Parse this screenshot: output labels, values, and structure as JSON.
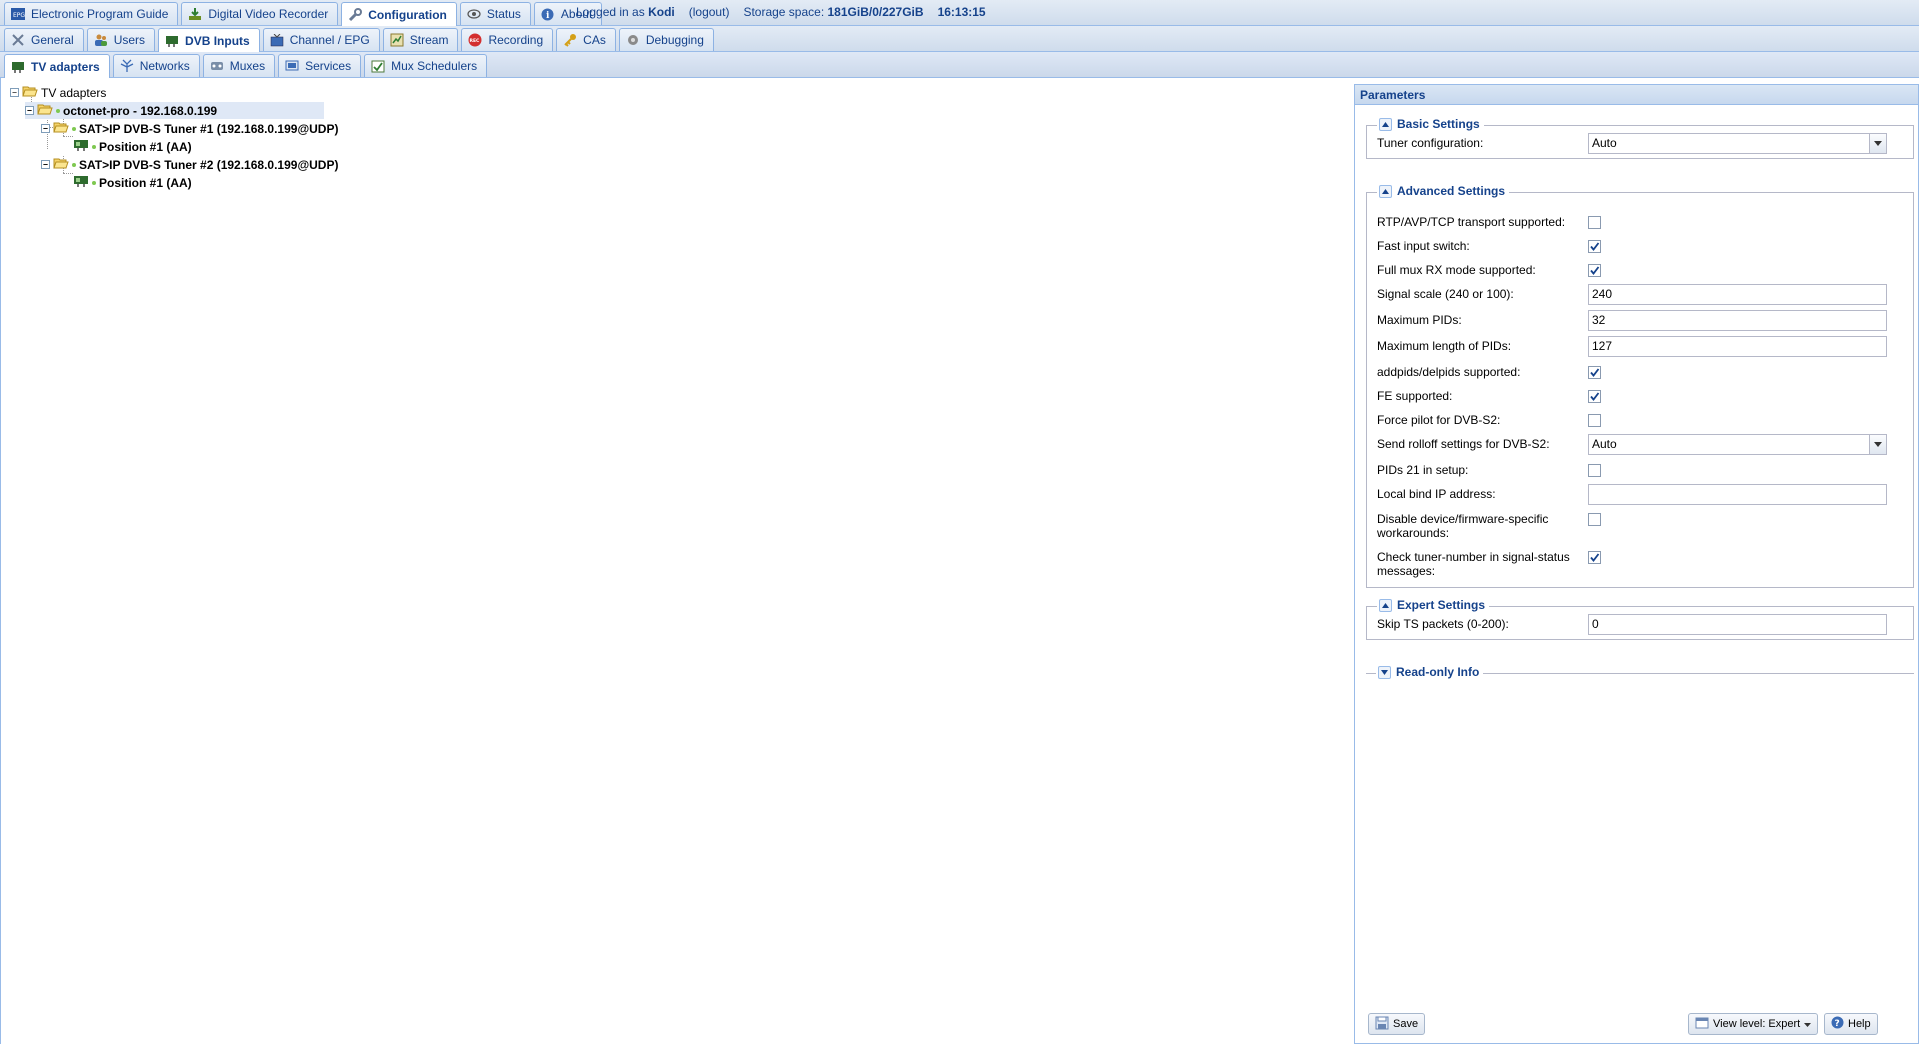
{
  "top_tabs": [
    {
      "label": "Electronic Program Guide",
      "icon": "epg-icon"
    },
    {
      "label": "Digital Video Recorder",
      "icon": "download-icon"
    },
    {
      "label": "Configuration",
      "icon": "wrench-icon"
    },
    {
      "label": "Status",
      "icon": "eye-icon"
    },
    {
      "label": "About",
      "icon": "info-icon"
    }
  ],
  "status": {
    "logged_in_prefix": "Logged in as",
    "user": "Kodi",
    "logout": "(logout)",
    "storage_prefix": "Storage space:",
    "storage_value": "181GiB/0/227GiB",
    "time": "16:13:15"
  },
  "config_tabs": [
    {
      "label": "General",
      "icon": "tools-icon"
    },
    {
      "label": "Users",
      "icon": "users-icon"
    },
    {
      "label": "DVB Inputs",
      "icon": "tv-card-icon"
    },
    {
      "label": "Channel / EPG",
      "icon": "tv-icon"
    },
    {
      "label": "Stream",
      "icon": "stream-icon"
    },
    {
      "label": "Recording",
      "icon": "rec-icon"
    },
    {
      "label": "CAs",
      "icon": "key-icon"
    },
    {
      "label": "Debugging",
      "icon": "bug-icon"
    }
  ],
  "dvb_tabs": [
    {
      "label": "TV adapters",
      "icon": "tv-card-icon"
    },
    {
      "label": "Networks",
      "icon": "antenna-icon"
    },
    {
      "label": "Muxes",
      "icon": "mux-icon"
    },
    {
      "label": "Services",
      "icon": "services-icon"
    },
    {
      "label": "Mux Schedulers",
      "icon": "scheduler-icon"
    }
  ],
  "tree": {
    "root": "TV adapters",
    "device": "octonet-pro - 192.168.0.199",
    "tuner1": "SAT>IP DVB-S Tuner #1 (192.168.0.199@UDP)",
    "tuner1_pos": "Position #1 (AA)",
    "tuner2": "SAT>IP DVB-S Tuner #2 (192.168.0.199@UDP)",
    "tuner2_pos": "Position #1 (AA)"
  },
  "params": {
    "title": "Parameters",
    "basic": {
      "legend": "Basic Settings",
      "tuner_config_label": "Tuner configuration:",
      "tuner_config_value": "Auto"
    },
    "advanced": {
      "legend": "Advanced Settings",
      "rtp_label": "RTP/AVP/TCP transport supported:",
      "rtp_checked": false,
      "fast_input_label": "Fast input switch:",
      "fast_input_checked": true,
      "full_mux_label": "Full mux RX mode supported:",
      "full_mux_checked": true,
      "signal_scale_label": "Signal scale (240 or 100):",
      "signal_scale_value": "240",
      "max_pids_label": "Maximum PIDs:",
      "max_pids_value": "32",
      "max_len_pids_label": "Maximum length of PIDs:",
      "max_len_pids_value": "127",
      "addpids_label": "addpids/delpids supported:",
      "addpids_checked": true,
      "fe_label": "FE supported:",
      "fe_checked": true,
      "force_pilot_label": "Force pilot for DVB-S2:",
      "force_pilot_checked": false,
      "rolloff_label": "Send rolloff settings for DVB-S2:",
      "rolloff_value": "Auto",
      "pids21_label": "PIDs 21 in setup:",
      "pids21_checked": false,
      "bind_ip_label": "Local bind IP address:",
      "bind_ip_value": "",
      "disable_workarounds_label": "Disable device/firmware-specific workarounds:",
      "disable_workarounds_checked": false,
      "check_tuner_label": "Check tuner-number in signal-status messages:",
      "check_tuner_checked": true
    },
    "expert": {
      "legend": "Expert Settings",
      "skip_ts_label": "Skip TS packets (0-200):",
      "skip_ts_value": "0"
    },
    "readonly": {
      "legend": "Read-only Info"
    }
  },
  "buttons": {
    "save": "Save",
    "view_level": "View level: Expert",
    "help": "Help"
  },
  "colors": {
    "accent": "#15428b",
    "border": "#99bbe8",
    "selected_row": "#dfe8f6"
  }
}
